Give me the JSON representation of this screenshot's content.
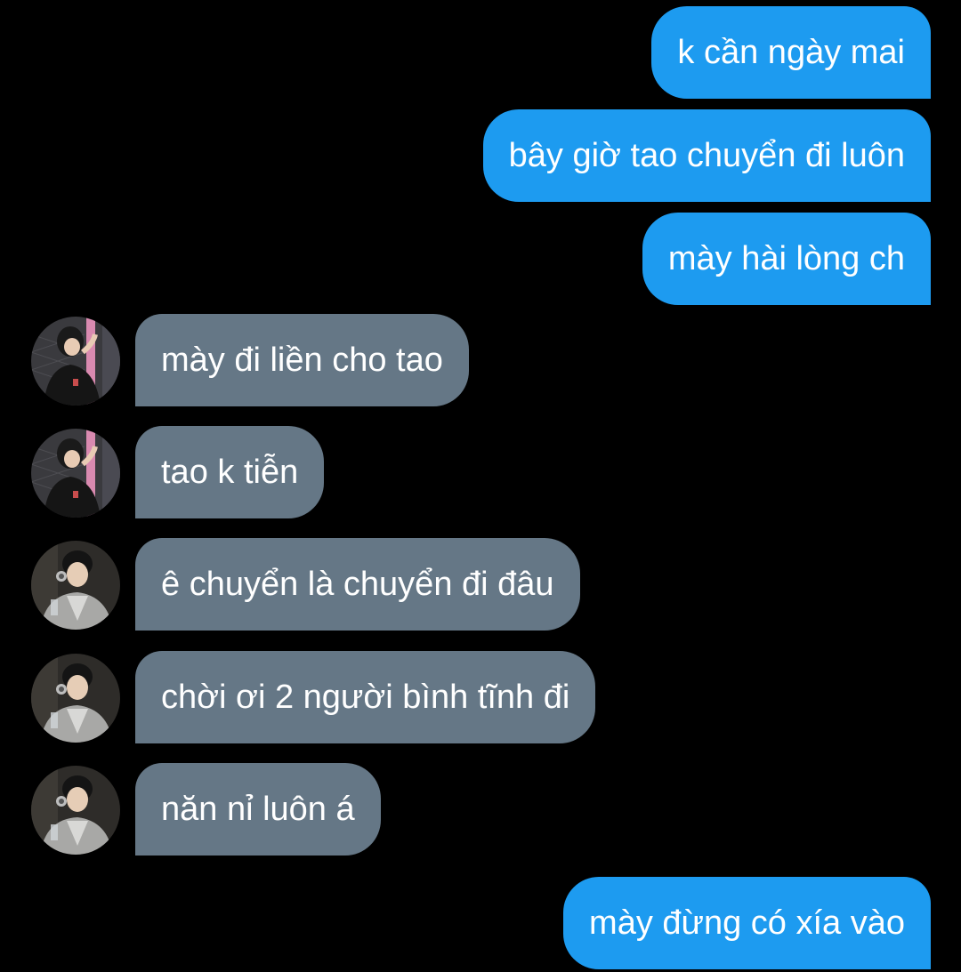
{
  "colors": {
    "background": "#000000",
    "sent_bubble": "#1d9bf0",
    "received_bubble": "#657786",
    "text": "#ffffff"
  },
  "messages": [
    {
      "direction": "sent",
      "text": "k cần ngày mai"
    },
    {
      "direction": "sent",
      "text": "bây giờ tao chuyển đi luôn"
    },
    {
      "direction": "sent",
      "text": "mày hài lòng ch"
    },
    {
      "direction": "received",
      "avatar": "avatar-pink-wall",
      "text": "mày đi liền cho tao"
    },
    {
      "direction": "received",
      "avatar": "avatar-pink-wall",
      "text": "tao k tiễn"
    },
    {
      "direction": "received",
      "avatar": "avatar-grey-hoodie",
      "text": "ê chuyển là chuyển đi đâu"
    },
    {
      "direction": "received",
      "avatar": "avatar-grey-hoodie",
      "text": "chời ơi 2 người bình tĩnh đi"
    },
    {
      "direction": "received",
      "avatar": "avatar-grey-hoodie",
      "text": "năn nỉ luôn á"
    },
    {
      "direction": "sent",
      "text": "mày đừng có xía vào"
    }
  ]
}
